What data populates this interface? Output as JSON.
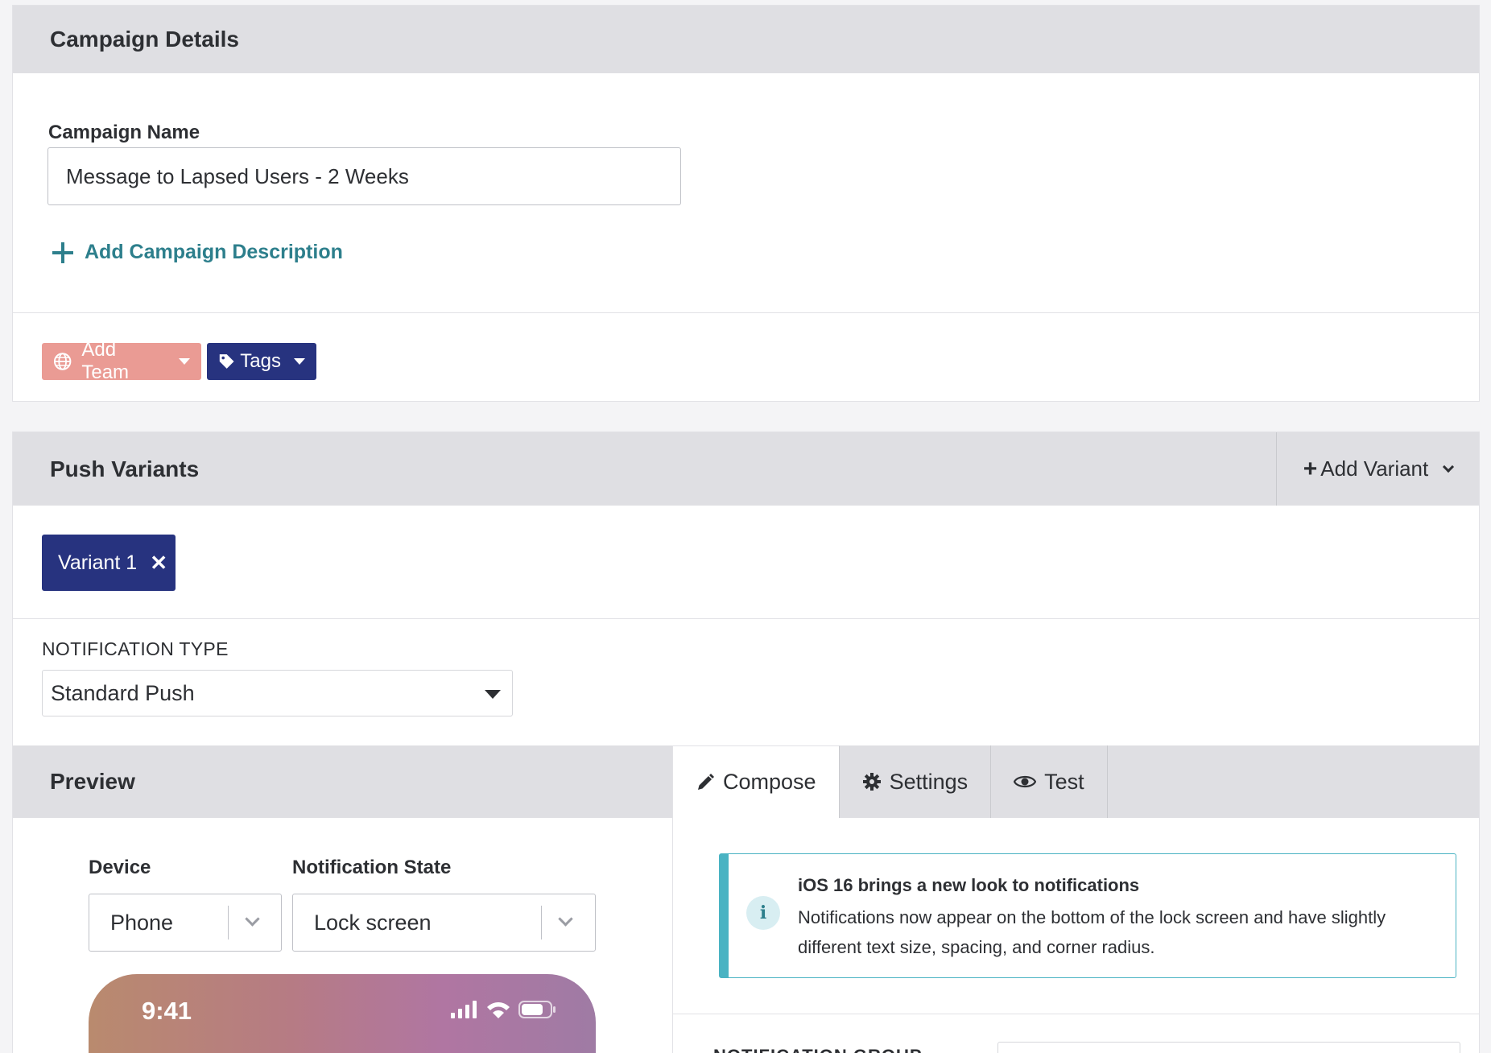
{
  "campaign": {
    "section_title": "Campaign Details",
    "name_label": "Campaign Name",
    "name_value": "Message to Lapsed Users - 2 Weeks",
    "add_description": "Add Campaign Description",
    "add_team": "Add Team",
    "tags": "Tags"
  },
  "variants": {
    "section_title": "Push Variants",
    "add_variant": "Add Variant",
    "chips": [
      "Variant 1"
    ],
    "notification_type_label": "NOTIFICATION TYPE",
    "notification_type_value": "Standard Push"
  },
  "preview": {
    "title": "Preview",
    "device_label": "Device",
    "device_value": "Phone",
    "state_label": "Notification State",
    "state_value": "Lock screen",
    "phone_time": "9:41"
  },
  "tabs": [
    {
      "label": "Compose",
      "icon": "pencil-icon",
      "active": true
    },
    {
      "label": "Settings",
      "icon": "gear-icon",
      "active": false
    },
    {
      "label": "Test",
      "icon": "eye-icon",
      "active": false
    }
  ],
  "info": {
    "title": "iOS 16 brings a new look to notifications",
    "body": "Notifications now appear on the bottom of the lock screen and have slightly different text size, spacing, and corner radius."
  },
  "notification_group_label": "NOTIFICATION GROUP",
  "colors": {
    "accent_teal": "#2d7f8c",
    "navy": "#27337f",
    "team_pill": "#ea9b94",
    "info_border": "#4ab3c3"
  }
}
